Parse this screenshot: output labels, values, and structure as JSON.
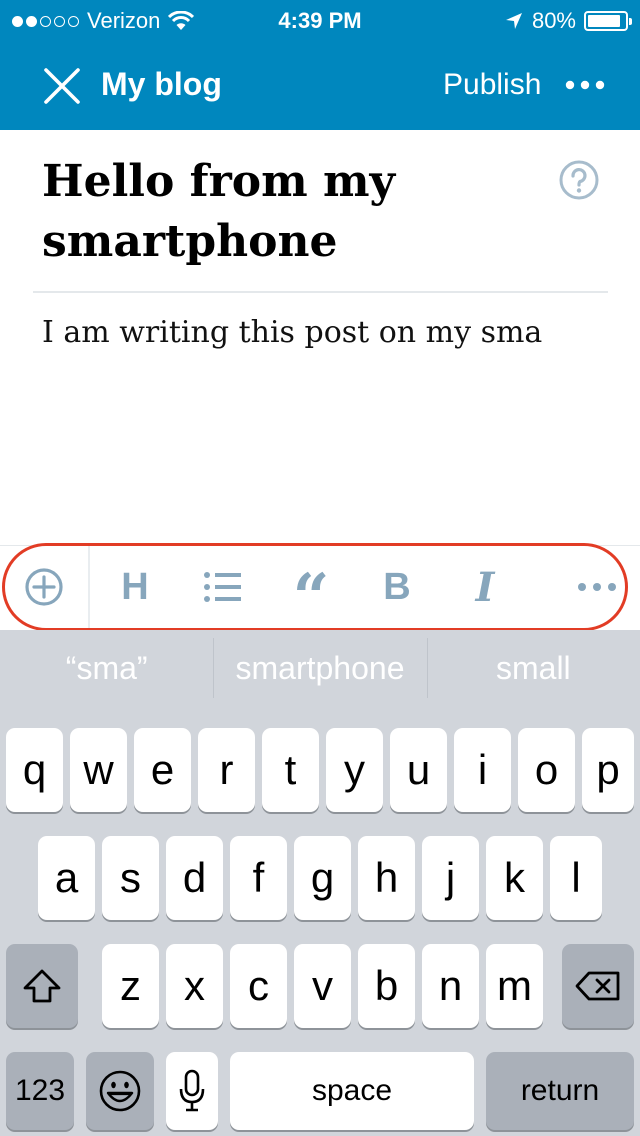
{
  "status_bar": {
    "carrier": "Verizon",
    "time": "4:39 PM",
    "battery": "80%"
  },
  "nav": {
    "title": "My blog",
    "publish_label": "Publish"
  },
  "post": {
    "title": "Hello from my smartphone",
    "body": "I am writing this post on my sma"
  },
  "toolbar": {
    "heading_label": "H",
    "quote_label": "“",
    "bold_label": "B",
    "italic_label": "I"
  },
  "predictions": [
    "“sma”",
    "smartphone",
    "small"
  ],
  "keyboard": {
    "row1": [
      "q",
      "w",
      "e",
      "r",
      "t",
      "y",
      "u",
      "i",
      "o",
      "p"
    ],
    "row2": [
      "a",
      "s",
      "d",
      "f",
      "g",
      "h",
      "j",
      "k",
      "l"
    ],
    "row3": [
      "z",
      "x",
      "c",
      "v",
      "b",
      "n",
      "m"
    ],
    "numbers_label": "123",
    "space_label": "space",
    "return_label": "return"
  },
  "colors": {
    "header_blue": "#0087be",
    "toolbar_icon": "#87a6bc",
    "highlight_red": "#e23c25",
    "keyboard_bg": "#d1d5db"
  }
}
